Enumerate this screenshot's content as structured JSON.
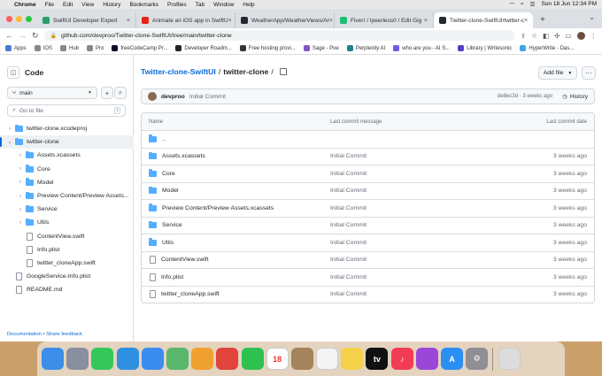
{
  "menubar": {
    "app": "Chrome",
    "items": [
      "File",
      "Edit",
      "View",
      "History",
      "Bookmarks",
      "Profiles",
      "Tab",
      "Window",
      "Help"
    ],
    "datetime": "Sun 18 Jun  12:34 PM"
  },
  "tabs": [
    {
      "label": "SwiftUI Developer Expert",
      "color": "#2c9e6c"
    },
    {
      "label": "Animate an iOS app in SwiftU",
      "color": "#e62117"
    },
    {
      "label": "WeatherApp/WeatherViews/Ar",
      "color": "#24292f"
    },
    {
      "label": "Fiverr / lpeerless0 / Edit Gig",
      "color": "#1dbf73"
    },
    {
      "label": "Twitter-clone-SwiftUI/twitter-c",
      "color": "#24292f",
      "active": true
    }
  ],
  "address": {
    "url": "github.com/devproo/Twitter-clone-SwiftUI/tree/main/twitter-clone"
  },
  "bookmarks": [
    {
      "label": "Apps",
      "color": "#4a7bd0"
    },
    {
      "label": "IOS",
      "color": "#888"
    },
    {
      "label": "Hub",
      "color": "#888"
    },
    {
      "label": "Pro",
      "color": "#888"
    },
    {
      "label": "freeCodeCamp Pr...",
      "color": "#0a0a23"
    },
    {
      "label": "Developer Roadm...",
      "color": "#222"
    },
    {
      "label": "Free hosting provi...",
      "color": "#333"
    },
    {
      "label": "Sage - Poe",
      "color": "#7e57c2"
    },
    {
      "label": "Perplexity AI",
      "color": "#20808d"
    },
    {
      "label": "who are you - AI S...",
      "color": "#6c5ce7"
    },
    {
      "label": "Library | Writesonic",
      "color": "#5b3cc4"
    },
    {
      "label": "HyperWrite - Das...",
      "color": "#3ba7e0"
    }
  ],
  "sidebar": {
    "title": "Code",
    "branch": "main",
    "goto_placeholder": "Go to file",
    "goto_shortcut": "t",
    "footer": "Documentation • Share feedback",
    "tree": [
      {
        "label": "twitter-clone.xcodeproj",
        "type": "folder",
        "depth": 0,
        "expanded": false
      },
      {
        "label": "twitter-clone",
        "type": "folder",
        "depth": 0,
        "expanded": true,
        "selected": true
      },
      {
        "label": "Assets.xcassets",
        "type": "folder",
        "depth": 1,
        "expanded": false
      },
      {
        "label": "Core",
        "type": "folder",
        "depth": 1,
        "expanded": false
      },
      {
        "label": "Model",
        "type": "folder",
        "depth": 1,
        "expanded": false
      },
      {
        "label": "Preview Content/Preview Assets...",
        "type": "folder",
        "depth": 1,
        "expanded": false
      },
      {
        "label": "Service",
        "type": "folder",
        "depth": 1,
        "expanded": false
      },
      {
        "label": "Utils",
        "type": "folder",
        "depth": 1,
        "expanded": false
      },
      {
        "label": "ContentView.swift",
        "type": "file",
        "depth": 1
      },
      {
        "label": "Info.plist",
        "type": "file",
        "depth": 1
      },
      {
        "label": "twitter_cloneApp.swift",
        "type": "file",
        "depth": 1
      },
      {
        "label": "GoogleService-Info.plist",
        "type": "file",
        "depth": 0
      },
      {
        "label": "README.md",
        "type": "file",
        "depth": 0
      }
    ]
  },
  "breadcrumb": {
    "repo": "Twitter-clone-SwiftUI",
    "folder": "twitter-clone",
    "sep": "/"
  },
  "add_file": "Add file",
  "commit": {
    "author": "devproo",
    "message": "Initial Commit",
    "meta": "de8ec3d · 3 weeks ago",
    "history": "History"
  },
  "table": {
    "headers": {
      "name": "Name",
      "message": "Last commit message",
      "date": "Last commit date"
    },
    "rows": [
      {
        "name": "..",
        "type": "folder",
        "message": "",
        "date": ""
      },
      {
        "name": "Assets.xcassets",
        "type": "folder",
        "message": "Initial Commit",
        "date": "3 weeks ago"
      },
      {
        "name": "Core",
        "type": "folder",
        "message": "Initial Commit",
        "date": "3 weeks ago"
      },
      {
        "name": "Model",
        "type": "folder",
        "message": "Initial Commit",
        "date": "3 weeks ago"
      },
      {
        "name": "Preview Content/Preview Assets.xcassets",
        "type": "folder",
        "message": "Initial Commit",
        "date": "3 weeks ago"
      },
      {
        "name": "Service",
        "type": "folder",
        "message": "Initial Commit",
        "date": "3 weeks ago"
      },
      {
        "name": "Utils",
        "type": "folder",
        "message": "Initial Commit",
        "date": "3 weeks ago"
      },
      {
        "name": "ContentView.swift",
        "type": "file",
        "message": "Initial Commit",
        "date": "3 weeks ago"
      },
      {
        "name": "Info.plist",
        "type": "file",
        "message": "Initial Commit",
        "date": "3 weeks ago"
      },
      {
        "name": "twitter_cloneApp.swift",
        "type": "file",
        "message": "Initial Commit",
        "date": "3 weeks ago"
      }
    ]
  },
  "dock": [
    {
      "name": "finder-icon",
      "color": "#3d8ee8",
      "glyph": ""
    },
    {
      "name": "launchpad-icon",
      "color": "#8a8fa0",
      "glyph": ""
    },
    {
      "name": "messages-icon",
      "color": "#35c759",
      "glyph": ""
    },
    {
      "name": "safari-icon",
      "color": "#2f8fe0",
      "glyph": ""
    },
    {
      "name": "mail-icon",
      "color": "#3a8cf0",
      "glyph": ""
    },
    {
      "name": "maps-icon",
      "color": "#58b76a",
      "glyph": ""
    },
    {
      "name": "photos-icon",
      "color": "#f0a030",
      "glyph": ""
    },
    {
      "name": "chrome-icon",
      "color": "#e0443a",
      "glyph": ""
    },
    {
      "name": "facetime-icon",
      "color": "#2dc24f",
      "glyph": ""
    },
    {
      "name": "calendar-icon",
      "color": "#ffffff",
      "glyph": "18"
    },
    {
      "name": "contacts-icon",
      "color": "#a5835c",
      "glyph": ""
    },
    {
      "name": "reminders-icon",
      "color": "#f4f4f4",
      "glyph": ""
    },
    {
      "name": "notes-icon",
      "color": "#f5d14a",
      "glyph": ""
    },
    {
      "name": "appletv-icon",
      "color": "#111111",
      "glyph": "tv"
    },
    {
      "name": "music-icon",
      "color": "#f23c55",
      "glyph": "♪"
    },
    {
      "name": "podcasts-icon",
      "color": "#9b46d9",
      "glyph": ""
    },
    {
      "name": "appstore-icon",
      "color": "#2b8ef3",
      "glyph": "A"
    },
    {
      "name": "system-settings-icon",
      "color": "#8e8e93",
      "glyph": "⚙"
    },
    {
      "name": "trash-icon",
      "color": "#dcdcdc",
      "glyph": ""
    }
  ]
}
